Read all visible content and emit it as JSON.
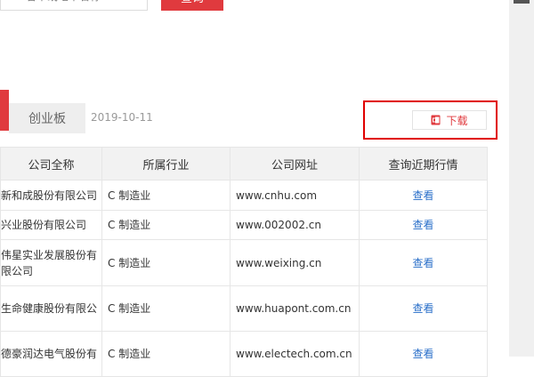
{
  "search": {
    "placeholder": "省市或地市名称",
    "button_label": "查询"
  },
  "board": {
    "tab_label": "创业板",
    "date": "2019-10-11"
  },
  "download": {
    "label": "下载",
    "icon": "ppt-file-icon",
    "highlight_color": "#e00000"
  },
  "colors": {
    "accent": "#e03a3e",
    "link": "#2a6fc9",
    "header_bg": "#f2f2f2"
  },
  "table": {
    "headers": [
      "公司全称",
      "所属行业",
      "公司网址",
      "查询近期行情"
    ],
    "rows": [
      {
        "name": "新和成股份有限公司",
        "industry": "C 制造业",
        "website": "www.cnhu.com",
        "action": "查看"
      },
      {
        "name": "兴业股份有限公司",
        "industry": "C 制造业",
        "website": "www.002002.cn",
        "action": "查看"
      },
      {
        "name": "伟星实业发展股份有限公司",
        "industry": "C 制造业",
        "website": "www.weixing.cn",
        "action": "查看"
      },
      {
        "name": "生命健康股份有限公",
        "industry": "C 制造业",
        "website": "www.huapont.com.cn",
        "action": "查看"
      },
      {
        "name": "德豪润达电气股份有",
        "industry": "C 制造业",
        "website": "www.electech.com.cn",
        "action": "查看"
      }
    ]
  }
}
